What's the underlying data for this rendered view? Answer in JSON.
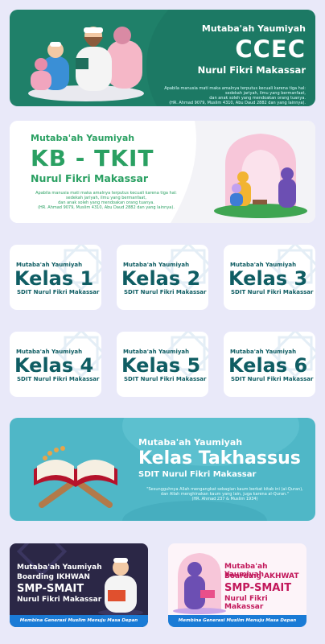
{
  "colors": {
    "page_bg": "#e9e9f9",
    "ccec_green": "#1f8069",
    "kb_green": "#2aa062",
    "kelas_teal": "#0f5d63",
    "takhassus_teal": "#4fb7c7",
    "ikhwan_navy": "#2b2746",
    "akhwat_pink": "#c2185b",
    "banner_blue": "#1a7bd6"
  },
  "ccec": {
    "subtitle": "Mutaba'ah Yaumiyah",
    "title": "CCEC",
    "school": "Nurul Fikri Makassar",
    "quote_1": "Apabila manusia mati maka amalnya terputus kecuali karena tiga hal:",
    "quote_2": "sedekah jariyah, ilmu yang bermanfaat,",
    "quote_3": "dan anak soleh yang mendoakan orang tuanya.",
    "quote_4": "(HR. Ahmad 9079, Muslim 4310, Abu Daud 2882 dan yang lainnya).",
    "illustration": "father-teaching-children-illustration"
  },
  "kb": {
    "subtitle": "Mutaba'ah Yaumiyah",
    "title": "KB - TKIT",
    "school": "Nurul Fikri Makassar",
    "quote_1": "Apabila manusia mati maka amalnya terputus kecuali karena tiga hal:",
    "quote_2": "sedekah jariyah, ilmu yang bermanfaat,",
    "quote_3": "dan anak soleh yang mendoakan orang tuanya.",
    "quote_4": "(HR. Ahmad 9079, Muslim 4310, Abu Daud 2882 dan yang lainnya).",
    "illustration": "mosque-children-reading-illustration"
  },
  "kelas": [
    {
      "top": "Mutaba'ah Yaumiyah",
      "label": "Kelas 1",
      "bottom": "SDIT Nurul Fikri Makassar"
    },
    {
      "top": "Mutaba'ah Yaumiyah",
      "label": "Kelas 2",
      "bottom": "SDIT Nurul Fikri Makassar"
    },
    {
      "top": "Mutaba'ah Yaumiyah",
      "label": "Kelas 3",
      "bottom": "SDIT Nurul Fikri Makassar"
    },
    {
      "top": "Mutaba'ah Yaumiyah",
      "label": "Kelas 4",
      "bottom": "SDIT Nurul Fikri Makassar"
    },
    {
      "top": "Mutaba'ah Yaumiyah",
      "label": "Kelas 5",
      "bottom": "SDIT Nurul Fikri Makassar"
    },
    {
      "top": "Mutaba'ah Yaumiyah",
      "label": "Kelas 6",
      "bottom": "SDIT Nurul Fikri Makassar"
    }
  ],
  "takhassus": {
    "subtitle": "Mutaba'ah Yaumiyah",
    "title": "Kelas Takhassus",
    "school": "SDIT Nurul Fikri Makassar",
    "quote_1": "\"Sesungguhnya Allah mengangkat sebagian kaum berkat kitab ini (al-Quran),",
    "quote_2": "dan Allah menghinakan kaum yang lain, juga karena al-Quran.\"",
    "quote_3": "(HR. Ahmad 237 & Muslim 1934)",
    "illustration": "quran-on-stand-illustration"
  },
  "ikhwan": {
    "line_1": "Mutaba'ah Yaumiyah",
    "line_2": "Boarding IKHWAN",
    "line_3": "SMP-SMAIT",
    "line_4": "Nurul Fikri Makassar",
    "banner": "Membina Generasi Muslim Menuju Masa Depan Gemilang",
    "illustration": "boy-reading-quran-illustration"
  },
  "akhwat": {
    "line_1": "Mutaba'ah Yaumiyah",
    "line_2": "Boarding AKHWAT",
    "line_3": "SMP-SMAIT",
    "line_4": "Nurul Fikri Makassar",
    "banner": "Membina Generasi Muslim Menuju Masa Depan Gemilang",
    "illustration": "girl-reading-quran-illustration"
  }
}
